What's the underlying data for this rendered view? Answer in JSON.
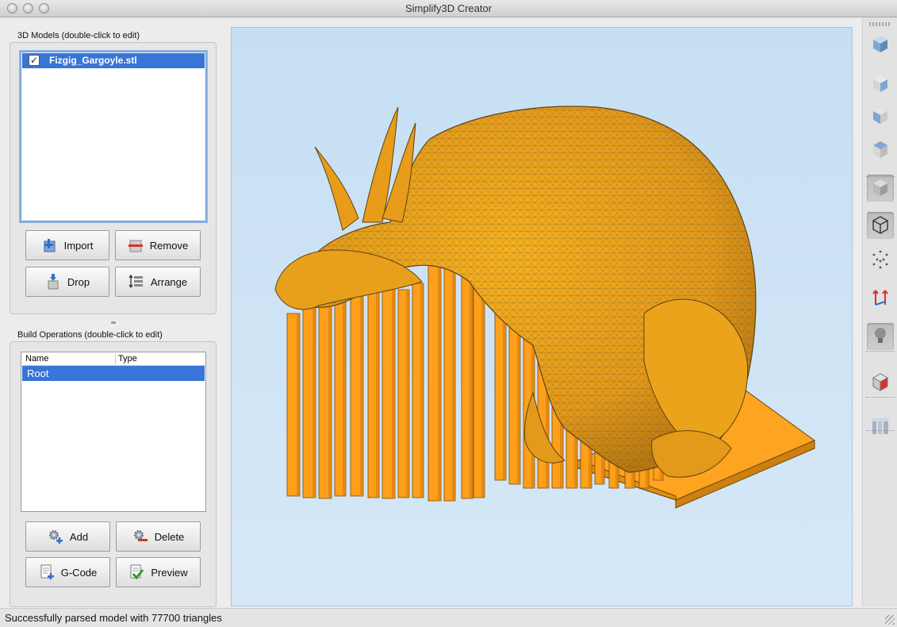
{
  "window": {
    "title": "Simplify3D Creator"
  },
  "models_panel": {
    "label": "3D Models (double-click to edit)",
    "items": [
      {
        "name": "Fizgig_Gargoyle.stl",
        "checked": true
      }
    ],
    "buttons": {
      "import": "Import",
      "remove": "Remove",
      "drop": "Drop",
      "arrange": "Arrange"
    }
  },
  "build_panel": {
    "label": "Build Operations (double-click to edit)",
    "columns": {
      "name": "Name",
      "type": "Type"
    },
    "rows": [
      {
        "name": "Root",
        "type": ""
      }
    ],
    "buttons": {
      "add": "Add",
      "delete": "Delete",
      "gcode": "G-Code",
      "preview": "Preview"
    }
  },
  "toolbar": {
    "tools": [
      {
        "icon": "view-iso-cube-icon"
      },
      {
        "icon": "view-front-cube-icon"
      },
      {
        "icon": "view-side-cube-icon"
      },
      {
        "icon": "view-top-cube-icon"
      },
      {
        "icon": "solid-mode-icon",
        "pressed": true
      },
      {
        "icon": "wireframe-mode-icon",
        "pressed": true
      },
      {
        "icon": "point-cloud-icon"
      },
      {
        "icon": "axes-icon"
      },
      {
        "icon": "lighting-icon",
        "pressed": true
      },
      {
        "icon": "cross-section-icon"
      },
      {
        "icon": "support-structure-icon"
      }
    ]
  },
  "viewport": {
    "model_color": "#f5a51b",
    "support_color": "#ff9f1a",
    "background_color": "#c9e1f5"
  },
  "status": {
    "message": "Successfully parsed model with 77700 triangles"
  }
}
